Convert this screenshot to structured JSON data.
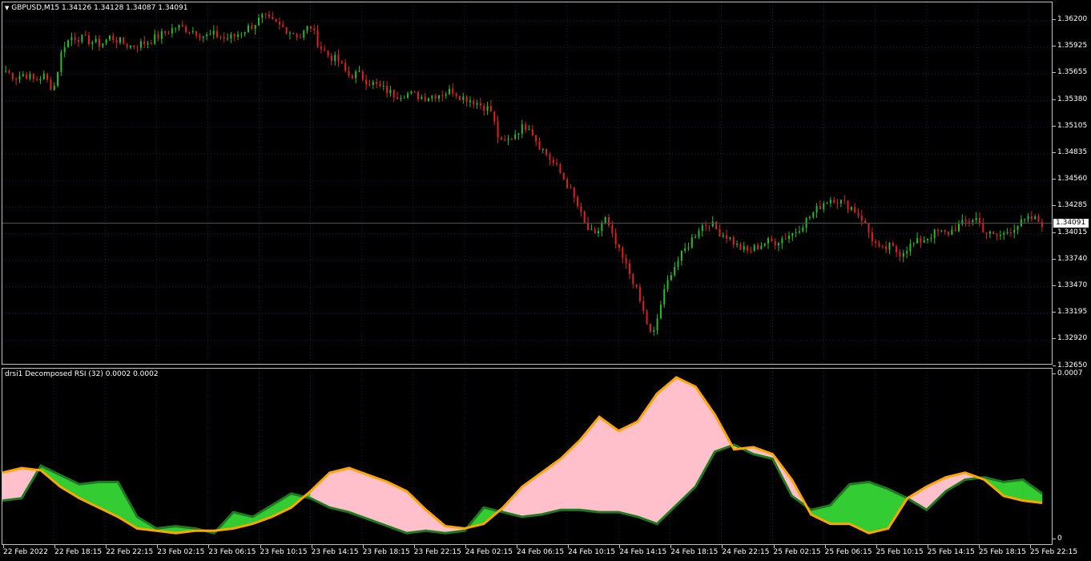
{
  "symbol_header": {
    "menu_arrow": "triangle-down",
    "text": "GBPUSD,M15  1.34126 1.34128 1.34087 1.34091"
  },
  "indicator_header": {
    "text": "drsi1 Decomposed RSI (32) 0.0002 0.0002"
  },
  "current_price": "1.34091",
  "price_scale": [
    "1.36200",
    "1.35925",
    "1.35655",
    "1.35380",
    "1.35105",
    "1.34835",
    "1.34560",
    "1.34285",
    "1.34015",
    "1.33740",
    "1.33470",
    "1.33195",
    "1.32920",
    "1.32650"
  ],
  "indicator_scale": [
    "0.0007",
    "0"
  ],
  "time_axis": [
    "22 Feb 2022",
    "22 Feb 18:15",
    "22 Feb 22:15",
    "23 Feb 02:15",
    "23 Feb 06:15",
    "23 Feb 10:15",
    "23 Feb 14:15",
    "23 Feb 18:15",
    "23 Feb 22:15",
    "24 Feb 02:15",
    "24 Feb 06:15",
    "24 Feb 10:15",
    "24 Feb 14:15",
    "24 Feb 18:15",
    "24 Feb 22:15",
    "25 Feb 02:15",
    "25 Feb 06:15",
    "25 Feb 10:15",
    "25 Feb 14:15",
    "25 Feb 18:15",
    "25 Feb 22:15"
  ],
  "colors": {
    "background": "#000000",
    "bull_candle": "#22c022",
    "bear_candle": "#e02020",
    "grid": "#1c1c40",
    "rsi_fast_line": "#ffa500",
    "rsi_slow_line": "#1e7a1e",
    "fill_up": "#ffc0cb",
    "fill_down": "#33cc33"
  },
  "chart_data": [
    {
      "type": "candlestick",
      "symbol": "GBPUSD",
      "timeframe": "M15",
      "ylim": [
        1.3265,
        1.3635
      ],
      "close_path": [
        1.3565,
        1.3558,
        1.3562,
        1.3555,
        1.356,
        1.3545,
        1.359,
        1.36,
        1.3598,
        1.3595,
        1.3592,
        1.36,
        1.3595,
        1.359,
        1.3592,
        1.3595,
        1.36,
        1.3605,
        1.361,
        1.3608,
        1.3605,
        1.36,
        1.3602,
        1.3598,
        1.36,
        1.3606,
        1.3612,
        1.362,
        1.3615,
        1.361,
        1.3605,
        1.36,
        1.3612,
        1.359,
        1.358,
        1.3575,
        1.356,
        1.3562,
        1.3555,
        1.355,
        1.3545,
        1.354,
        1.3542,
        1.354,
        1.3538,
        1.354,
        1.3542,
        1.3545,
        1.3538,
        1.3535,
        1.353,
        1.3525,
        1.349,
        1.3495,
        1.3505,
        1.351,
        1.349,
        1.3478,
        1.3465,
        1.345,
        1.343,
        1.3405,
        1.3395,
        1.3415,
        1.339,
        1.337,
        1.335,
        1.332,
        1.329,
        1.333,
        1.336,
        1.3375,
        1.339,
        1.3405,
        1.341,
        1.34,
        1.3395,
        1.3385,
        1.338,
        1.3385,
        1.339,
        1.339,
        1.3395,
        1.34,
        1.341,
        1.342,
        1.343,
        1.3435,
        1.343,
        1.3425,
        1.3415,
        1.3395,
        1.338,
        1.3385,
        1.3378,
        1.3385,
        1.339,
        1.3395,
        1.34,
        1.3398,
        1.3405,
        1.341,
        1.3415,
        1.34,
        1.3395,
        1.3398,
        1.3405,
        1.341,
        1.3414,
        1.3409
      ]
    },
    {
      "type": "area",
      "name": "drsi1 Decomposed RSI (32)",
      "ylim": [
        0,
        0.0007
      ],
      "fast": [
        0.00028,
        0.0003,
        0.00029,
        0.00022,
        0.00017,
        0.00013,
        9e-05,
        4e-05,
        3e-05,
        2e-05,
        3e-05,
        3e-05,
        4e-05,
        6e-05,
        9e-05,
        0.00013,
        0.0002,
        0.00028,
        0.0003,
        0.00027,
        0.00024,
        0.0002,
        0.00012,
        5e-05,
        4e-05,
        6e-05,
        0.00013,
        0.00022,
        0.00028,
        0.00034,
        0.00042,
        0.00052,
        0.00046,
        0.0005,
        0.00062,
        0.00069,
        0.00065,
        0.00053,
        0.00038,
        0.00039,
        0.00036,
        0.00025,
        0.0001,
        6e-05,
        6e-05,
        2e-05,
        4e-05,
        0.00017,
        0.00022,
        0.00026,
        0.00028,
        0.00025,
        0.00018,
        0.00016,
        0.00015
      ],
      "slow": [
        0.00016,
        0.00017,
        0.00031,
        0.00027,
        0.00023,
        0.00024,
        0.00024,
        9e-05,
        4e-05,
        5e-05,
        4e-05,
        2e-05,
        0.00011,
        9e-05,
        0.00014,
        0.00019,
        0.00017,
        0.00013,
        0.00011,
        8e-05,
        5e-05,
        2e-05,
        3e-05,
        2e-05,
        3e-05,
        0.00013,
        0.00011,
        9e-05,
        0.0001,
        0.00012,
        0.00012,
        0.00011,
        0.00011,
        9e-05,
        6e-05,
        0.00014,
        0.00022,
        0.00037,
        0.0004,
        0.00036,
        0.00034,
        0.00018,
        0.00012,
        0.00014,
        0.00023,
        0.00024,
        0.00021,
        0.00017,
        0.00012,
        0.0002,
        0.00025,
        0.00026,
        0.00024,
        0.00025,
        0.00019
      ]
    }
  ]
}
